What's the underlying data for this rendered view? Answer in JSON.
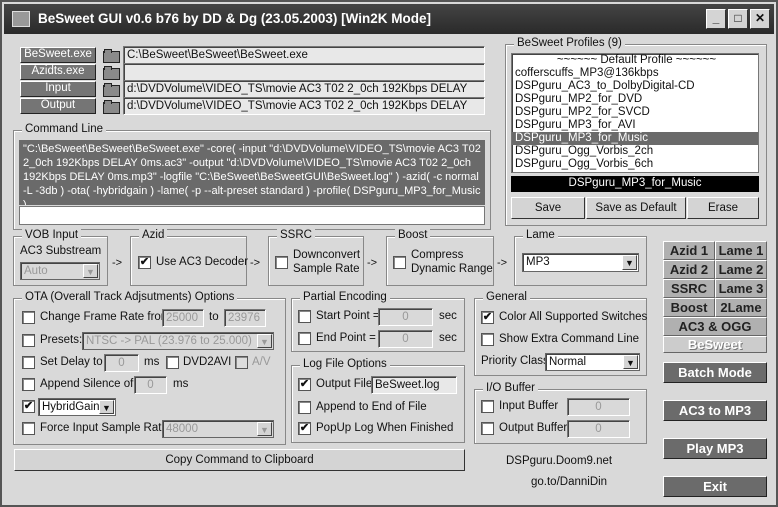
{
  "window": {
    "title": "BeSweet GUI v0.6 b76 by DD & Dg (23.05.2003)  [Win2K Mode]",
    "min": "_",
    "max": "□",
    "close": "✕"
  },
  "paths": [
    {
      "button": "BeSweet.exe",
      "value": "C:\\BeSweet\\BeSweet\\BeSweet.exe"
    },
    {
      "button": "Azidts.exe",
      "value": ""
    },
    {
      "button": "Input",
      "value": "d:\\DVDVolume\\VIDEO_TS\\movie AC3 T02 2_0ch 192Kbps DELAY"
    },
    {
      "button": "Output",
      "value": "d:\\DVDVolume\\VIDEO_TS\\movie AC3 T02 2_0ch 192Kbps DELAY"
    }
  ],
  "command": {
    "title": "Command Line",
    "text": "\"C:\\BeSweet\\BeSweet\\BeSweet.exe\" -core( -input \"d:\\DVDVolume\\VIDEO_TS\\movie AC3 T02 2_0ch 192Kbps DELAY 0ms.ac3\" -output \"d:\\DVDVolume\\VIDEO_TS\\movie AC3 T02 2_0ch 192Kbps DELAY 0ms.mp3\" -logfile \"C:\\BeSweet\\BeSweetGUI\\BeSweet.log\" ) -azid( -c normal -L -3db ) -ota( -hybridgain ) -lame( -p --alt-preset standard ) -profile( DSPguru_MP3_for_Music )"
  },
  "profiles": {
    "title": "BeSweet Profiles (9)",
    "items": [
      "~~~~~~ Default Profile ~~~~~~",
      "cofferscuffs_MP3@136kbps",
      "DSPguru_AC3_to_DolbyDigital-CD",
      "DSPguru_MP2_for_DVD",
      "DSPguru_MP2_for_SVCD",
      "DSPguru_MP3_for_AVI",
      "DSPguru_MP3_for_Music",
      "DSPguru_Ogg_Vorbis_2ch",
      "DSPguru_Ogg_Vorbis_6ch"
    ],
    "selected_index": 6,
    "active": "DSPguru_MP3_for_Music",
    "save": "Save",
    "save_default": "Save as Default",
    "erase": "Erase"
  },
  "vob": {
    "title": "VOB Input",
    "label": "AC3 Substream",
    "value": "Auto"
  },
  "azid": {
    "title": "Azid",
    "label": "Use AC3 Decoder",
    "checked": true
  },
  "ssrc": {
    "title": "SSRC",
    "label1": "Downconvert",
    "label2": "Sample Rate",
    "checked": false
  },
  "boost": {
    "title": "Boost",
    "label1": "Compress",
    "label2": "Dynamic Range",
    "checked": false
  },
  "lame": {
    "title": "Lame",
    "value": "MP3"
  },
  "arrow": "->",
  "ota": {
    "title": "OTA (Overall Track Adjsutments) Options",
    "frame_rate": {
      "label": "Change Frame Rate from",
      "from": "25000",
      "to_label": "to",
      "to": "23976"
    },
    "presets": {
      "label": "Presets:",
      "value": "NTSC -> PAL    (23.976 to 25.000)"
    },
    "delay": {
      "label": "Set Delay to",
      "value": "0",
      "unit": "ms",
      "dvd2avi": "DVD2AVI",
      "av": "A/V"
    },
    "silence": {
      "label": "Append Silence of",
      "value": "0",
      "unit": "ms"
    },
    "hybrid": {
      "value": "HybridGain",
      "checked": true
    },
    "force": {
      "label": "Force Input Sample Rate",
      "value": "48000"
    }
  },
  "partial": {
    "title": "Partial Encoding",
    "start": "Start Point =",
    "end": "End Point =",
    "start_val": "0",
    "end_val": "0",
    "unit": "sec"
  },
  "log": {
    "title": "Log File Options",
    "output": "Output File",
    "file": "BeSweet.log",
    "append": "Append to End of File",
    "popup": "PopUp Log When Finished"
  },
  "general": {
    "title": "General",
    "color": "Color All Supported Switches",
    "extra": "Show Extra Command Line",
    "priority_label": "Priority Class",
    "priority": "Normal"
  },
  "io": {
    "title": "I/O Buffer",
    "input": "Input Buffer",
    "output": "Output Buffer",
    "input_val": "0",
    "output_val": "0"
  },
  "copy": "Copy Command to Clipboard",
  "links": [
    "DSPguru.Doom9.net",
    "go.to/DanniDin"
  ],
  "side": {
    "azid1": "Azid 1",
    "lame1": "Lame 1",
    "azid2": "Azid 2",
    "lame2": "Lame 2",
    "ssrc": "SSRC",
    "lame3": "Lame 3",
    "boost": "Boost",
    "lame2b": "2Lame",
    "ac3ogg": "AC3 & OGG",
    "besweet": "BeSweet",
    "batch": "Batch Mode",
    "ac3mp3": "AC3 to MP3",
    "play": "Play MP3",
    "exit": "Exit"
  }
}
